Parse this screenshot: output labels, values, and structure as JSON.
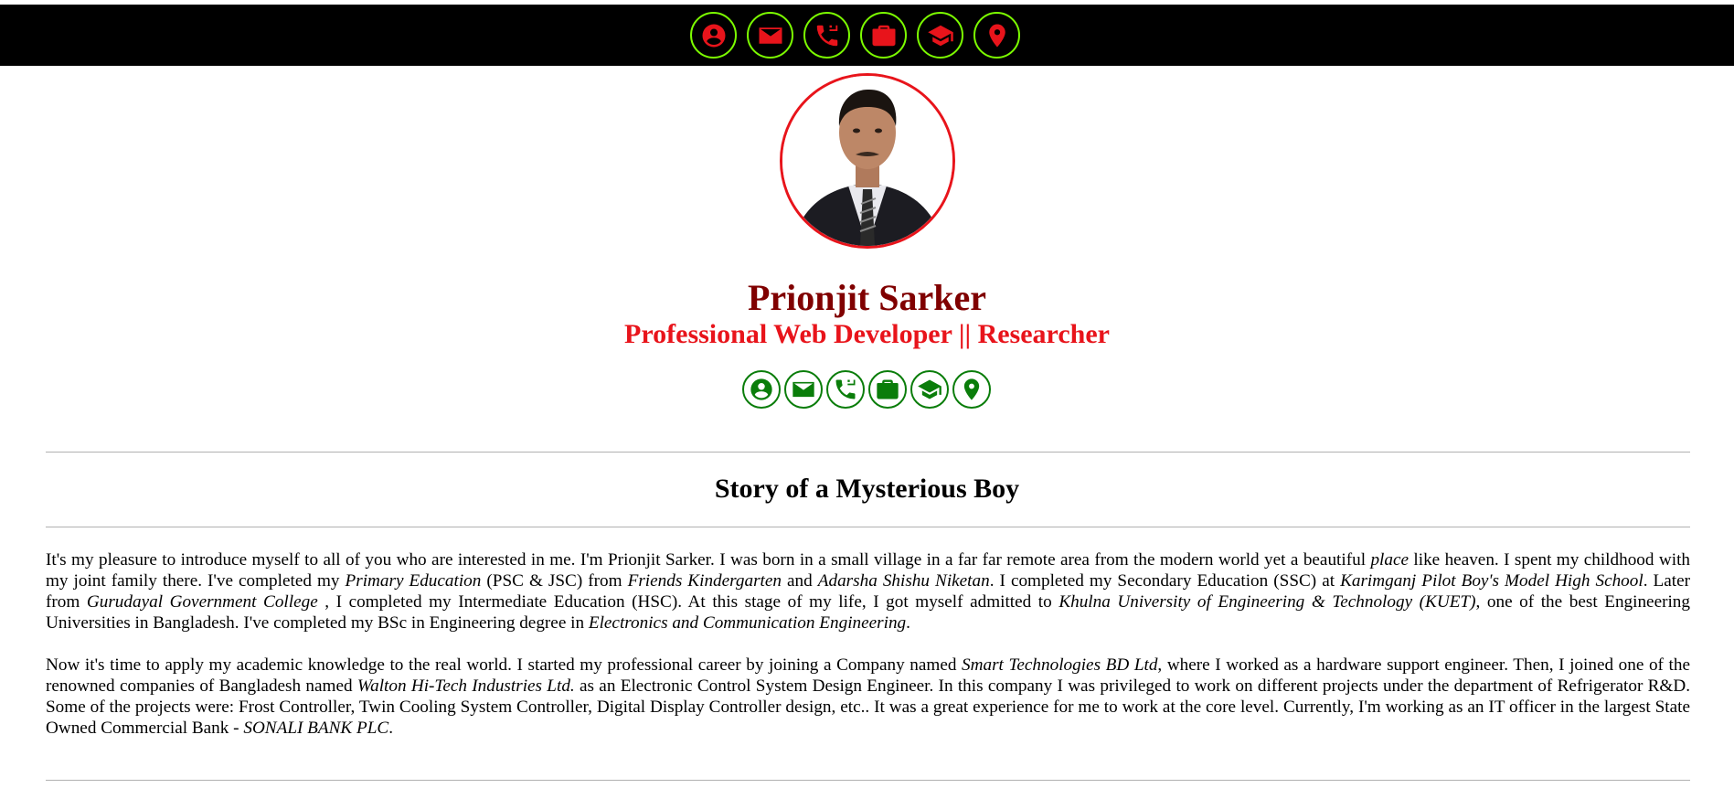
{
  "nav_icons": [
    "user-icon",
    "mail-icon",
    "phone-icon",
    "briefcase-icon",
    "graduation-cap-icon",
    "location-pin-icon"
  ],
  "colors": {
    "accent_red": "#e8141b",
    "name_maroon": "#800000",
    "social_green": "#0a7d0a",
    "nav_ring": "#7cfc00"
  },
  "profile": {
    "name": "Prionjit Sarker",
    "subtitle": "Professional Web Developer || Researcher"
  },
  "story": {
    "title": "Story of a Mysterious Boy",
    "p1": [
      {
        "t": "It's my pleasure to introduce myself to all of you who are interested in me. I'm Prionjit Sarker. I was born in a small village in a far far remote area from the modern world yet a beautiful "
      },
      {
        "i": "place"
      },
      {
        "t": " like heaven. I spent my childhood with my joint family there. I've completed my "
      },
      {
        "i": "Primary Education"
      },
      {
        "t": " (PSC & JSC) from "
      },
      {
        "i": "Friends Kindergarten"
      },
      {
        "t": " and "
      },
      {
        "i": "Adarsha Shishu Niketan"
      },
      {
        "t": ". I completed my Secondary Education (SSC) at "
      },
      {
        "i": "Karimganj Pilot Boy's Model High School"
      },
      {
        "t": ". Later from "
      },
      {
        "i": "Gurudayal Government College"
      },
      {
        "t": " , I completed my Intermediate Education (HSC). At this stage of my life, I got myself admitted to "
      },
      {
        "i": "Khulna University of Engineering & Technology (KUET)"
      },
      {
        "t": ", one of the best Engineering Universities in Bangladesh. I've completed my BSc in Engineering degree in "
      },
      {
        "i": "Electronics and Communication Engineering"
      },
      {
        "t": "."
      }
    ],
    "p2": [
      {
        "t": "Now it's time to apply my academic knowledge to the real world. I started my professional career by joining a Company named "
      },
      {
        "i": "Smart Technologies BD Ltd"
      },
      {
        "t": ", where I worked as a hardware support engineer. Then, I joined one of the renowned companies of Bangladesh named "
      },
      {
        "i": "Walton Hi-Tech Industries Ltd."
      },
      {
        "t": " as an Electronic Control System Design Engineer. In this company I was privileged to work on different projects under the department of Refrigerator R&D. Some of the projects were: Frost Controller, Twin Cooling System Controller, Digital Display Controller design, etc.. It was a great experience for me to work at the core level. Currently, I'm working as an IT officer in the largest State Owned Commercial Bank - "
      },
      {
        "i": "SONALI BANK PLC"
      },
      {
        "t": "."
      }
    ]
  }
}
